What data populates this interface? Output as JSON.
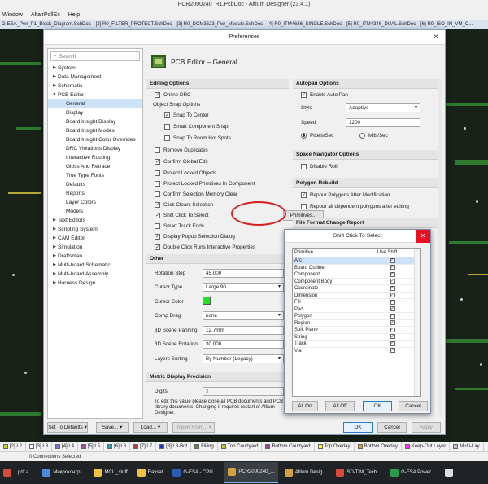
{
  "app": {
    "title": "PCR2000240_R1.PcbDoc - Altium Designer (23.4.1)",
    "menu": [
      "Window",
      "AltairPollEx",
      "Help"
    ],
    "doc_tabs": [
      "G-ESA_Pwr_P1_Block_Diagram.SchDoc",
      "[2] R0_FILTER_PROTECT.SchDoc",
      "[3] R0_DCM3623_Pwr_Module.SchDoc",
      "[4] R0_ITM4636_SINGLE.SchDoc",
      "[5] R0_ITM4346_DUAL.SchDoc",
      "[6] R0_ISO_IN_VM_C..."
    ]
  },
  "prefs": {
    "title": "Preferences",
    "search_placeholder": "Search",
    "tree": [
      {
        "label": "System",
        "level": 0,
        "expanded": false
      },
      {
        "label": "Data Management",
        "level": 0,
        "expanded": false
      },
      {
        "label": "Schematic",
        "level": 0,
        "expanded": false
      },
      {
        "label": "PCB Editor",
        "level": 0,
        "expanded": true
      },
      {
        "label": "General",
        "level": 1,
        "selected": true
      },
      {
        "label": "Display",
        "level": 1
      },
      {
        "label": "Board Insight Display",
        "level": 1
      },
      {
        "label": "Board Insight Modes",
        "level": 1
      },
      {
        "label": "Board Insight Color Overrides",
        "level": 1
      },
      {
        "label": "DRC Violations Display",
        "level": 1
      },
      {
        "label": "Interactive Routing",
        "level": 1
      },
      {
        "label": "Gloss And Retrace",
        "level": 1
      },
      {
        "label": "True Type Fonts",
        "level": 1
      },
      {
        "label": "Defaults",
        "level": 1
      },
      {
        "label": "Reports",
        "level": 1
      },
      {
        "label": "Layer Colors",
        "level": 1
      },
      {
        "label": "Models",
        "level": 1
      },
      {
        "label": "Text Editors",
        "level": 0,
        "expanded": false
      },
      {
        "label": "Scripting System",
        "level": 0,
        "expanded": false
      },
      {
        "label": "CAM Editor",
        "level": 0,
        "expanded": false
      },
      {
        "label": "Simulation",
        "level": 0,
        "expanded": false
      },
      {
        "label": "Draftsman",
        "level": 0,
        "expanded": false
      },
      {
        "label": "Multi-board Schematic",
        "level": 0,
        "expanded": false
      },
      {
        "label": "Multi-board Assembly",
        "level": 0,
        "expanded": false
      },
      {
        "label": "Harness Design",
        "level": 0,
        "expanded": false
      }
    ],
    "page_title": "PCB Editor – General",
    "editing_options": {
      "header": "Editing Options",
      "online_drc": {
        "label": "Online DRC",
        "checked": true
      },
      "object_snap_label": "Object Snap Options",
      "snap_to_center": {
        "label": "Snap To Center",
        "checked": true
      },
      "smart_component_snap": {
        "label": "Smart Component Snap",
        "checked": false
      },
      "snap_to_room_hot_spots": {
        "label": "Snap To Room Hot Spots",
        "checked": false
      },
      "remove_duplicates": {
        "label": "Remove Duplicates",
        "checked": false
      },
      "confirm_global_edit": {
        "label": "Confirm Global Edit",
        "checked": true
      },
      "protect_locked_objects": {
        "label": "Protect Locked Objects",
        "checked": false
      },
      "protect_locked_primitives": {
        "label": "Protect Locked Primitives In Component",
        "checked": false
      },
      "confirm_selection_memory_clear": {
        "label": "Confirm Selection Memory Clear",
        "checked": false
      },
      "click_clears_selection": {
        "label": "Click Clears Selection",
        "checked": true
      },
      "shift_click_to_select": {
        "label": "Shift Click To Select",
        "checked": true
      },
      "primitives_button": "Primitives...",
      "smart_track_ends": {
        "label": "Smart Track Ends",
        "checked": false
      },
      "display_popup_selection": {
        "label": "Display Popup Selection Dialog",
        "checked": true
      },
      "double_click_runs_interactive": {
        "label": "Double Click Runs Interactive Properties",
        "checked": true
      }
    },
    "other": {
      "header": "Other",
      "rotation_step": {
        "label": "Rotation Step",
        "value": "45.000"
      },
      "cursor_type": {
        "label": "Cursor Type",
        "value": "Large 90"
      },
      "cursor_color": {
        "label": "Cursor Color",
        "color": "#22e022"
      },
      "comp_drag": {
        "label": "Comp Drag",
        "value": "none"
      },
      "scene_panning": {
        "label": "3D Scene Panning",
        "value": "12.7mm"
      },
      "scene_rotation": {
        "label": "3D Scene Rotation",
        "value": "30.000"
      },
      "layers_sorting": {
        "label": "Layers Sorting",
        "value": "By Number (Legacy)"
      }
    },
    "metric": {
      "header": "Metric Display Precision",
      "digits": {
        "label": "Digits",
        "value": "3"
      },
      "note": "To edit this value please close all PCB documents and PCB library documents. Changing it requires restart of Altium Designer."
    },
    "autopan": {
      "header": "Autopan Options",
      "enable": {
        "label": "Enable Auto Pan",
        "checked": true
      },
      "style": {
        "label": "Style",
        "value": "Adaptive"
      },
      "speed": {
        "label": "Speed",
        "value": "1200"
      },
      "units_pixels": "Pixels/Sec",
      "units_mils": "Mils/Sec",
      "units_selected": "Pixels/Sec"
    },
    "space_nav": {
      "header": "Space Navigator Options",
      "disable_roll": {
        "label": "Disable Roll",
        "checked": false
      }
    },
    "polygon": {
      "header": "Polygon Rebuild",
      "repour_after_mod": {
        "label": "Repour Polygons After Modification",
        "checked": true
      },
      "repour_all": {
        "label": "Repour all dependent polygons after editing",
        "checked": false
      }
    },
    "file_format": {
      "header": "File Format Change Report"
    },
    "footer": {
      "set_to_defaults": "Set To Defaults",
      "save": "Save...",
      "load": "Load...",
      "import_from": "Import From...",
      "ok": "OK",
      "cancel": "Cancel",
      "apply": "Apply"
    }
  },
  "shift_click_dialog": {
    "title": "Shift Click To Select",
    "col_primitive": "Primitive",
    "col_use_shift": "Use Shift",
    "rows": [
      {
        "name": "Arc",
        "checked": true
      },
      {
        "name": "Board Outline",
        "checked": true
      },
      {
        "name": "Component",
        "checked": true
      },
      {
        "name": "Component Body",
        "checked": true
      },
      {
        "name": "Coordinate",
        "checked": true
      },
      {
        "name": "Dimension",
        "checked": true
      },
      {
        "name": "Fill",
        "checked": true
      },
      {
        "name": "Pad",
        "checked": true
      },
      {
        "name": "Polygon",
        "checked": true
      },
      {
        "name": "Region",
        "checked": true
      },
      {
        "name": "Split Plane",
        "checked": true
      },
      {
        "name": "String",
        "checked": true
      },
      {
        "name": "Track",
        "checked": true
      },
      {
        "name": "Via",
        "checked": true
      }
    ],
    "all_on": "All On",
    "all_off": "All Off",
    "ok": "OK",
    "cancel": "Cancel"
  },
  "layers": [
    {
      "label": "[2] L2",
      "color": "#d0d030"
    },
    {
      "label": "[3] L3",
      "color": "#ffffff"
    },
    {
      "label": "[4] L4",
      "color": "#7a7adc"
    },
    {
      "label": "[5] L5",
      "color": "#a050a0"
    },
    {
      "label": "[6] L6",
      "color": "#30a0a0"
    },
    {
      "label": "[7] L7",
      "color": "#b04040"
    },
    {
      "label": "[8] L8-Bot",
      "color": "#2030c0"
    },
    {
      "label": "Filling",
      "color": "#6a8a3a"
    },
    {
      "label": "Top Courtyard",
      "color": "#c0c040"
    },
    {
      "label": "Bottom Courtyard",
      "color": "#a040a0"
    },
    {
      "label": "Top Overlay",
      "color": "#ffff00"
    },
    {
      "label": "Bottom Overlay",
      "color": "#e0a020"
    },
    {
      "label": "Keep-Out Layer",
      "color": "#ff30ff"
    },
    {
      "label": "Multi-Lay",
      "color": "#c0c0c0"
    }
  ],
  "status": "0 Connections Selected",
  "taskbar": [
    {
      "label": "...pdf a...",
      "color": "#d84a3a"
    },
    {
      "label": "Микроконтр...",
      "color": "#4b8ae0"
    },
    {
      "label": "MCU_stuff",
      "color": "#f0c040"
    },
    {
      "label": "Raysat",
      "color": "#f0c040"
    },
    {
      "label": "G-ESA - CPU ...",
      "color": "#2a5db0"
    },
    {
      "label": "PCR2000240_...",
      "color": "#d4a040"
    },
    {
      "label": "Altium Desig...",
      "color": "#d4a040"
    },
    {
      "label": "SD-TIM_Tech...",
      "color": "#d84a3a"
    },
    {
      "label": "G-ESA Power...",
      "color": "#2a9a4a"
    },
    {
      "label": "",
      "color": "#dddddd"
    }
  ]
}
